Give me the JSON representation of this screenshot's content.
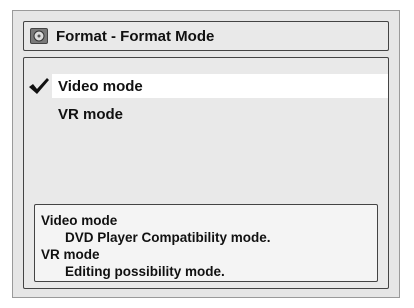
{
  "title": "Format - Format Mode",
  "options": [
    {
      "label": "Video mode",
      "selected": true
    },
    {
      "label": "VR mode",
      "selected": false
    }
  ],
  "info": {
    "line1": "Video mode",
    "line2": "DVD Player Compatibility mode.",
    "line3": "VR mode",
    "line4": "Editing possibility mode."
  }
}
